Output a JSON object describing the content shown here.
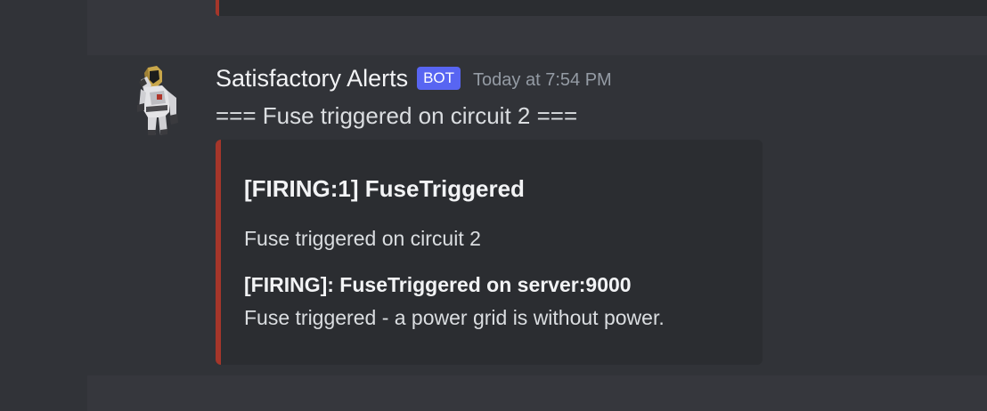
{
  "previous_message": {
    "embed_color": "#a5362a"
  },
  "message": {
    "avatar_icon": "pioneer-character-avatar",
    "author": "Satisfactory Alerts",
    "bot_tag": "BOT",
    "timestamp": "Today at 7:54 PM",
    "content": "=== Fuse triggered on circuit 2 ===",
    "embed": {
      "color": "#a5362a",
      "title": "[FIRING:1] FuseTriggered",
      "description": "Fuse triggered on circuit 2",
      "field_title": "[FIRING]: FuseTriggered on server:9000",
      "field_value": "Fuse triggered - a power grid is without power."
    }
  },
  "colors": {
    "background": "#313338",
    "embed_background": "#2b2d31",
    "bot_tag": "#5865f2",
    "timestamp": "#949ba4"
  }
}
